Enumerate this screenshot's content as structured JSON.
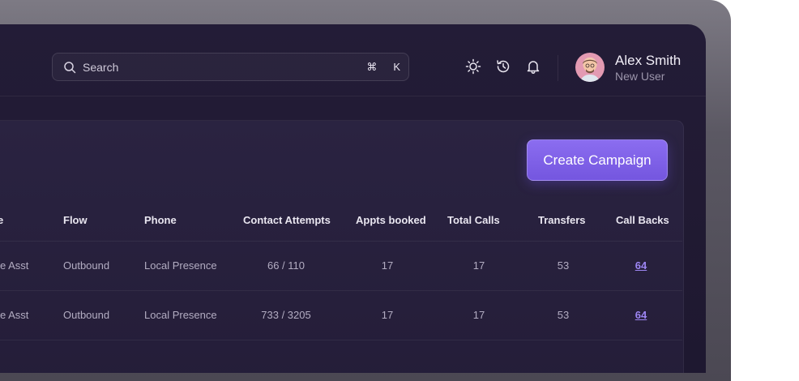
{
  "search": {
    "placeholder": "Search",
    "shortcut_modifier": "⌘",
    "shortcut_key": "K"
  },
  "header_icons": [
    "sun-icon",
    "history-icon",
    "bell-icon"
  ],
  "user": {
    "name": "Alex Smith",
    "role": "New User"
  },
  "actions": {
    "create_campaign": "Create Campaign"
  },
  "table": {
    "columns": [
      "e",
      "Flow",
      "Phone",
      "Contact Attempts",
      "Appts booked",
      "Total Calls",
      "Transfers",
      "Call Backs"
    ],
    "rows": [
      {
        "name": "e Asst",
        "flow": "Outbound",
        "phone": "Local Presence",
        "contact_attempts": "66 / 110",
        "appts_booked": "17",
        "total_calls": "17",
        "transfers": "53",
        "call_backs": "64"
      },
      {
        "name": "e Asst",
        "flow": "Outbound",
        "phone": "Local Presence",
        "contact_attempts": "733 / 3205",
        "appts_booked": "17",
        "total_calls": "17",
        "transfers": "53",
        "call_backs": "64"
      }
    ]
  },
  "colors": {
    "accent": "#7c5ee8",
    "link": "#9d86f3",
    "background": "#221b35"
  }
}
